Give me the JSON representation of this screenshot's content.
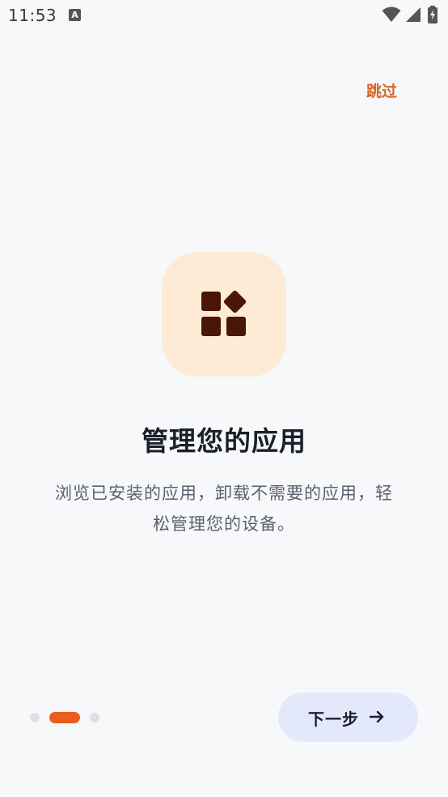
{
  "status_bar": {
    "time": "11:53",
    "notification_icon_letter": "A",
    "icons": [
      "wifi-icon",
      "cellular-signal-icon",
      "battery-charging-icon"
    ]
  },
  "header": {
    "skip_label": "跳过"
  },
  "onboarding": {
    "illustration_icon": "apps-grid-icon",
    "title": "管理您的应用",
    "description": "浏览已安装的应用，卸载不需要的应用，轻松管理您的设备。",
    "page_indicator": {
      "total_pages": 3,
      "current_page": 2
    }
  },
  "footer": {
    "next_label": "下一步",
    "next_icon": "arrow-right-icon"
  },
  "colors": {
    "background": "#f7f8fa",
    "accent": "#e95d1e",
    "skip_text": "#d9641e",
    "hero_card_bg": "#fdebd5",
    "hero_icon": "#4a1608",
    "next_button_bg": "#e3e9fb",
    "title_text": "#1b1f2a",
    "body_text": "#5b6070"
  }
}
